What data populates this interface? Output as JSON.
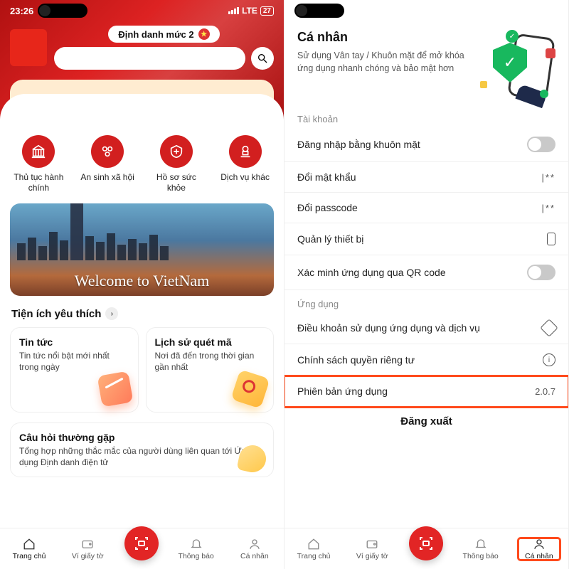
{
  "phone1": {
    "status": {
      "time": "23:26",
      "net": "LTE",
      "battery": "27"
    },
    "level_chip": "Định danh mức 2",
    "quick_actions": [
      {
        "label": "Thủ tục hành chính"
      },
      {
        "label": "An sinh xã hội"
      },
      {
        "label": "Hồ sơ sức khỏe"
      },
      {
        "label": "Dịch vụ khác"
      }
    ],
    "banner_text": "Welcome to VietNam",
    "fav_section": "Tiện ích yêu thích",
    "tiles": {
      "news_title": "Tin tức",
      "news_sub": "Tin tức nổi bật mới nhất trong ngày",
      "scan_title": "Lịch sử quét mã",
      "scan_sub": "Nơi đã đến trong thời gian gần nhất"
    },
    "faq": {
      "title": "Câu hỏi thường gặp",
      "sub": "Tổng hợp những thắc mắc của người dùng liên quan tới Ứng dụng Định danh điện tử"
    },
    "nav": {
      "home": "Trang chủ",
      "wallet": "Ví giấy tờ",
      "noti": "Thông báo",
      "profile": "Cá nhân"
    }
  },
  "phone2": {
    "title": "Cá nhân",
    "subtitle": "Sử dụng Vân tay / Khuôn mặt để mở khóa ứng dụng nhanh chóng và bảo mật hơn",
    "group_account": "Tài khoản",
    "rows": {
      "face_login": "Đăng nhập bằng khuôn mặt",
      "change_pw": "Đổi mật khẩu",
      "change_passcode": "Đổi passcode",
      "devices": "Quản lý thiết bị",
      "verify_qr": "Xác minh ứng dụng qua QR code"
    },
    "masked": "|**",
    "group_app": "Ứng dụng",
    "app_rows": {
      "terms": "Điều khoản sử dụng ứng dụng và dịch vụ",
      "privacy": "Chính sách quyền riêng tư",
      "version_label": "Phiên bản ứng dụng",
      "version_value": "2.0.7"
    },
    "logout": "Đăng xuất",
    "nav": {
      "home": "Trang chủ",
      "wallet": "Ví giấy tờ",
      "noti": "Thông báo",
      "profile": "Cá nhân"
    }
  }
}
